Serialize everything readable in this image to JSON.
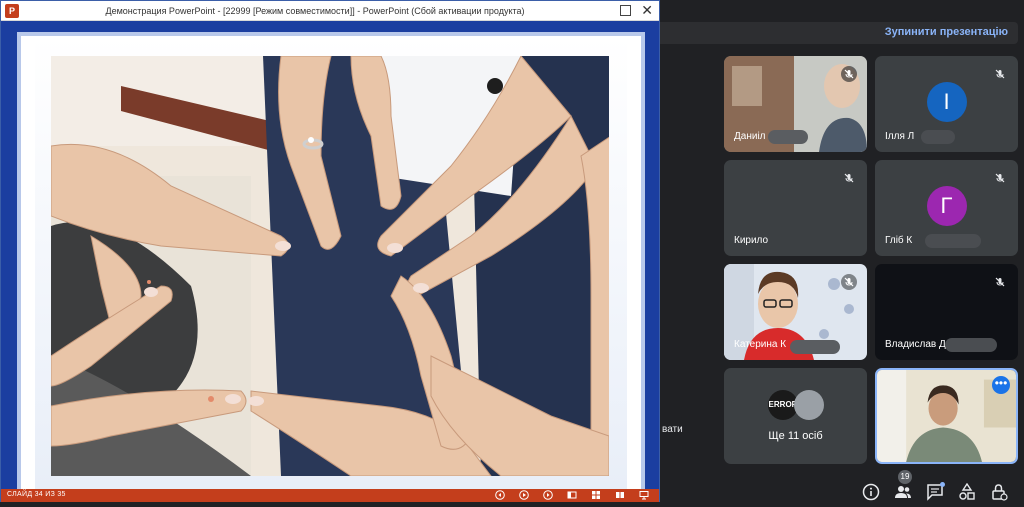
{
  "powerpoint": {
    "title": "Демонстрация PowerPoint - [22999 [Режим совместимости]] - PowerPoint (Сбой активации продукта)",
    "logo_letter": "P",
    "close_glyph": "✕",
    "slide_counter": "СЛАЙД 34 ИЗ 35",
    "status_icons": [
      "prev-icon",
      "play-icon",
      "next-icon",
      "normal-view-icon",
      "slide-sorter-icon",
      "reading-view-icon",
      "slideshow-icon"
    ]
  },
  "meet": {
    "stop_presentation": "Зупинити презентацію",
    "participants": [
      {
        "id": "daniil",
        "name": "Даниіл",
        "type": "video",
        "muted": true
      },
      {
        "id": "illia",
        "name": "Ілля Л",
        "type": "avatar",
        "initial": "І",
        "color": "#1565c0",
        "muted": true
      },
      {
        "id": "kyrylo",
        "name": "Кирило",
        "type": "blank",
        "muted": true
      },
      {
        "id": "hlib",
        "name": "Гліб К",
        "type": "avatar",
        "initial": "Г",
        "color": "#9c27b0",
        "muted": true
      },
      {
        "id": "kateryna",
        "name": "Катерина К",
        "type": "video",
        "muted": true
      },
      {
        "id": "vladyslav",
        "name": "Владислав Д",
        "type": "dark",
        "muted": true
      }
    ],
    "more": {
      "label": "Ще 11 осіб",
      "avatar1_text": "ERROR"
    },
    "self_options_glyph": "•••",
    "stray_text": "вати",
    "people_count": "19",
    "controls": [
      "info-icon",
      "people-icon",
      "chat-icon",
      "activities-icon",
      "host-controls-icon"
    ]
  }
}
